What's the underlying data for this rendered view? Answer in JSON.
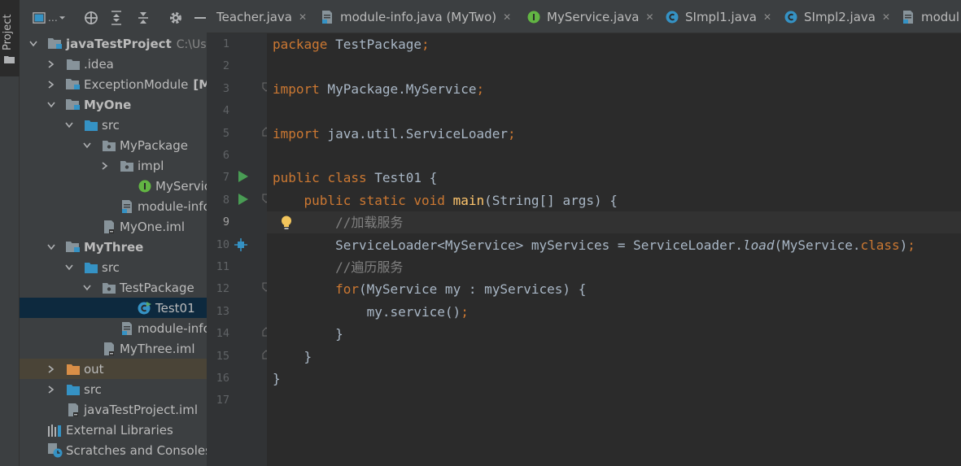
{
  "tool_strip": {
    "project_tab_label": "Project"
  },
  "project_tree": [
    {
      "label": "javaTestProject",
      "suffix": "C:\\Users\\",
      "bold": true,
      "depth": 0,
      "expanded": true,
      "icon": "module-folder-icon"
    },
    {
      "label": ".idea",
      "depth": 1,
      "expanded": false,
      "icon": "folder-icon"
    },
    {
      "label": "ExceptionModule",
      "suffix_bold": "[MyT",
      "depth": 1,
      "expanded": false,
      "icon": "module-folder-icon"
    },
    {
      "label": "MyOne",
      "bold": true,
      "depth": 1,
      "expanded": true,
      "icon": "module-folder-icon"
    },
    {
      "label": "src",
      "depth": 2,
      "expanded": true,
      "icon": "source-folder-icon"
    },
    {
      "label": "MyPackage",
      "depth": 3,
      "expanded": true,
      "icon": "package-icon"
    },
    {
      "label": "impl",
      "depth": 4,
      "expanded": false,
      "icon": "package-icon"
    },
    {
      "label": "MyService",
      "depth": 5,
      "icon": "interface-icon"
    },
    {
      "label": "module-info.java",
      "depth": 4,
      "icon": "java-file-icon"
    },
    {
      "label": "MyOne.iml",
      "depth": 3,
      "icon": "iml-file-icon"
    },
    {
      "label": "MyThree",
      "bold": true,
      "depth": 1,
      "expanded": true,
      "icon": "module-folder-icon"
    },
    {
      "label": "src",
      "depth": 2,
      "expanded": true,
      "icon": "source-folder-icon"
    },
    {
      "label": "TestPackage",
      "depth": 3,
      "expanded": true,
      "icon": "package-icon"
    },
    {
      "label": "Test01",
      "depth": 5,
      "icon": "class-run-icon",
      "selected": true
    },
    {
      "label": "module-info.java",
      "depth": 4,
      "icon": "java-file-icon"
    },
    {
      "label": "MyThree.iml",
      "depth": 3,
      "icon": "iml-file-icon"
    },
    {
      "label": "out",
      "depth": 1,
      "expanded": false,
      "icon": "excluded-folder-icon",
      "excluded": true
    },
    {
      "label": "src",
      "depth": 1,
      "expanded": false,
      "icon": "source-folder-icon"
    },
    {
      "label": "javaTestProject.iml",
      "depth": 1,
      "icon": "iml-file-icon"
    },
    {
      "label": "External Libraries",
      "depth": 0,
      "icon": "libraries-icon"
    },
    {
      "label": "Scratches and Consoles",
      "depth": 0,
      "icon": "scratches-icon"
    }
  ],
  "tabs": [
    {
      "label": "Teacher.java",
      "icon": "none"
    },
    {
      "label": "module-info.java (MyTwo)",
      "icon": "java-file-icon"
    },
    {
      "label": "MyService.java",
      "icon": "interface-icon"
    },
    {
      "label": "SImpl1.java",
      "icon": "class-icon"
    },
    {
      "label": "SImpl2.java",
      "icon": "class-icon"
    },
    {
      "label": "modul",
      "icon": "java-file-icon"
    }
  ],
  "editor": {
    "current_line": 9,
    "lines": [
      "package TestPackage;",
      "",
      "import MyPackage.MyService;",
      "",
      "import java.util.ServiceLoader;",
      "",
      "public class Test01 {",
      "    public static void main(String[] args) {",
      "        //加载服务",
      "        ServiceLoader<MyService> myServices = ServiceLoader.load(MyService.class);",
      "        //遍历服务",
      "        for(MyService my : myServices) {",
      "            my.service();",
      "        }",
      "    }",
      "}",
      ""
    ]
  },
  "colors": {
    "keyword": "#cc7832",
    "method_decl": "#ffc66d",
    "comment": "#808080",
    "default_text": "#a9b7c6",
    "selection": "#0d293e"
  }
}
